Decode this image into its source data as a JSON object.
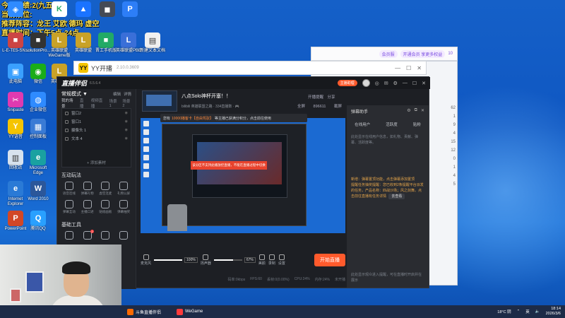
{
  "overlay": {
    "line1": "今日战绩:2(九五)",
    "line2": "当前段位:",
    "line3": "推荐阵容：龙王 艾欧 德玛 虚空",
    "line4": "直播时间：下午5点-24点"
  },
  "desktop_icons": [
    {
      "label": "",
      "color": "#2f8bff",
      "glyph": "◈"
    },
    {
      "label": "",
      "color": "#ffffff",
      "glyph": "K"
    },
    {
      "label": "",
      "color": "#1a73ff",
      "glyph": "▲"
    },
    {
      "label": "",
      "color": "#444a55",
      "glyph": "◼"
    },
    {
      "label": "",
      "color": "#2d7ef7",
      "glyph": "P"
    },
    {
      "label": "L-E-TE5-SN...",
      "color": "#c44",
      "glyph": "■"
    },
    {
      "label": "solutionPro...",
      "color": "#333",
      "glyph": "■"
    },
    {
      "label": "英雄联盟WeGame版",
      "color": "#c9a227",
      "glyph": "L"
    },
    {
      "label": "英雄联盟",
      "color": "#c9a227",
      "glyph": "L"
    },
    {
      "label": "晋工手机版",
      "color": "#2a6",
      "glyph": "■"
    },
    {
      "label": "英雄联盟PBE",
      "color": "#3a6fd8",
      "glyph": "L"
    },
    {
      "label": "新建文本文档",
      "color": "#f0f0f0",
      "glyph": "▤"
    },
    {
      "label": "此电脑",
      "color": "#3aa0ff",
      "glyph": "▣"
    },
    {
      "label": "微信",
      "color": "#1aad19",
      "glyph": "◉"
    },
    {
      "label": "英雄联盟",
      "color": "#c9a227",
      "glyph": "L"
    },
    {
      "label": "Snipaste",
      "color": "#e03ab0",
      "glyph": "✂"
    },
    {
      "label": "企业微信",
      "color": "#2f8bff",
      "glyph": "◍"
    },
    {
      "label": "YY语音",
      "color": "#f5c400",
      "glyph": "Y"
    },
    {
      "label": "控制面板",
      "color": "#3a7bd5",
      "glyph": "▦"
    },
    {
      "label": "回收站",
      "color": "#d8e2ee",
      "glyph": "▥"
    },
    {
      "label": "Microsoft Edge",
      "color": "#1aa1a1",
      "glyph": "e"
    },
    {
      "label": "Internet Explorer",
      "color": "#2a7ad6",
      "glyph": "e"
    },
    {
      "label": "Word 2010",
      "color": "#2b579a",
      "glyph": "W"
    },
    {
      "label": "PowerPoint",
      "color": "#d24726",
      "glyph": "P"
    },
    {
      "label": "腾讯QQ",
      "color": "#29a0ff",
      "glyph": "Q"
    }
  ],
  "browser_back": {
    "badge1": "会员服",
    "badge2": "开通会员 享更多权益",
    "badge3": "10",
    "numbers": [
      "62",
      "1",
      "9",
      "4",
      "15",
      "12",
      "0",
      "1",
      "4",
      "5"
    ]
  },
  "yy": {
    "logo": "YY",
    "name": "YY开播",
    "version": "2.10.0.3609",
    "controls": [
      "—",
      "☐",
      "✕"
    ]
  },
  "app": {
    "brand": "直播伴侣",
    "version": "6.5.6.4",
    "pro": "主播助理",
    "window_controls": [
      "◎",
      "✉",
      "⚙",
      "—",
      "☐",
      "✕"
    ],
    "mode": "常规模式 ▼",
    "mode_actions": [
      "编辑",
      "详情"
    ],
    "scene_header": "我的场景",
    "scenes": [
      "直播",
      "视频直播",
      "场景1",
      "场景2"
    ],
    "sources": [
      "窗口2",
      "窗口1",
      "摄像头 1",
      "文本 4"
    ],
    "add_source": "+ 添加素材",
    "section_interact": "互动玩法",
    "interact_tools": [
      "语音连线",
      "弹幕礼物",
      "虚空连麦",
      "礼物公屏",
      "弹幕互动",
      "主播口述",
      "贴纸画板",
      "弹幕抽奖"
    ],
    "section_basic": "基础工具",
    "stream_title": "八点Solo神杯开塞！！",
    "stream_meta": "bilibili 英雄联盟之路 · 334直播数 · 🎮",
    "stream_actions": [
      "开播提醒",
      "分享",
      "全屏",
      "截屏"
    ],
    "online": "896611",
    "notice_pre": "您有",
    "notice_hl": "10000播客卡【自由驾驭】",
    "notice_post": "等主播已获满分积分，点击前往使用",
    "preview_warning": "该分区不支持此播放控直播，不能在直播过程中切换",
    "mic_label": "麦克风",
    "mic_pct": "100%",
    "mic_level": 1.0,
    "spk_label": "扬声器",
    "spk_pct": "67%",
    "spk_level": 0.67,
    "mini_controls": [
      "美颜",
      "录制",
      "设置"
    ],
    "start_btn": "开始直播",
    "status": [
      "码率:0kbps",
      "FPS:60",
      "丢帧:0(0.00%)",
      "CPU:24%",
      "内存:24%",
      "未开播"
    ],
    "rp_title": "弹幕助手",
    "rp_tabs": [
      "在线用户",
      "活跃度",
      "贴粉"
    ],
    "rp_body": "此处显示在线用户信息，如礼物、贡献、弹幕、活跃度等。",
    "rp_msg1": "新增：弹幕置顶功能，点击弹幕添加置顶",
    "rp_msg2": "提醒任务抽奖提醒：您已收到2条提醒平台派发的任务，产品名称：四战沙场；风之剑舞。点击前往直播有任务详情",
    "rp_msg_btn": "去查看",
    "rp_foot": "此处显示观众进入提醒，可在直播时开启并在展示"
  },
  "taskbar": {
    "items": [
      {
        "label": "斗鱼直播伴侣",
        "color": "#ff6a00"
      },
      {
        "label": "WeGame",
        "color": "#ff3b3b"
      }
    ],
    "weather": "18°C 阴",
    "ime": "英",
    "time": "18:14",
    "date": "2026/3/6"
  }
}
